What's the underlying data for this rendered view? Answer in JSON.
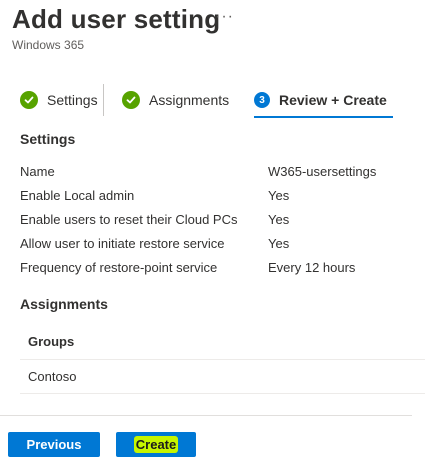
{
  "header": {
    "title": "Add user setting",
    "more_label": "···",
    "subtitle": "Windows 365"
  },
  "tabs": [
    {
      "label": "Settings",
      "state": "complete"
    },
    {
      "label": "Assignments",
      "state": "complete"
    },
    {
      "label": "Review + Create",
      "state": "active",
      "step": "3"
    }
  ],
  "settings_section": {
    "heading": "Settings",
    "rows": [
      {
        "key": "Name",
        "value": "W365-usersettings"
      },
      {
        "key": "Enable Local admin",
        "value": "Yes"
      },
      {
        "key": "Enable users to reset their Cloud PCs",
        "value": "Yes"
      },
      {
        "key": "Allow user to initiate restore service",
        "value": "Yes"
      },
      {
        "key": "Frequency of restore-point service",
        "value": "Every 12 hours"
      }
    ]
  },
  "assignments_section": {
    "heading": "Assignments",
    "column_header": "Groups",
    "groups": [
      "Contoso"
    ]
  },
  "footer": {
    "previous_label": "Previous",
    "create_label": "Create"
  },
  "colors": {
    "accent": "#0078d4",
    "success": "#57a300",
    "highlight": "#c6f500"
  }
}
